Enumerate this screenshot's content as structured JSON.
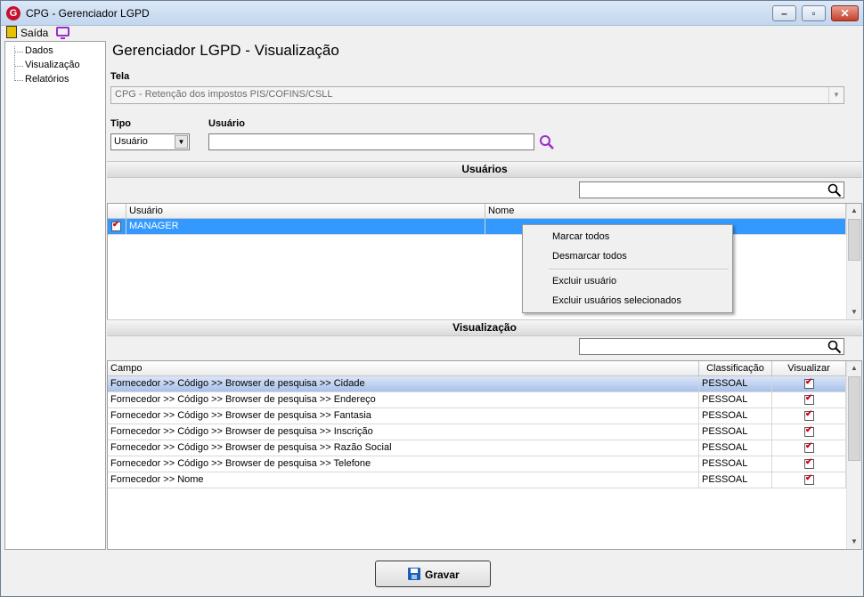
{
  "window": {
    "title": "CPG - Gerenciador LGPD"
  },
  "menubar": {
    "saida": "Saída"
  },
  "sidebar": {
    "items": [
      "Dados",
      "Visualização",
      "Relatórios"
    ]
  },
  "page": {
    "heading": "Gerenciador LGPD - Visualização"
  },
  "form": {
    "tela_label": "Tela",
    "tela_value": "CPG - Retenção dos impostos PIS/COFINS/CSLL",
    "tipo_label": "Tipo",
    "tipo_value": "Usuário",
    "usuario_label": "Usuário",
    "usuario_value": ""
  },
  "usuarios_section": {
    "title": "Usuários",
    "columns": [
      "Usuário",
      "Nome"
    ],
    "rows": [
      {
        "checked": true,
        "usuario": "MANAGER",
        "nome": ""
      }
    ]
  },
  "context_menu": {
    "items": [
      "Marcar todos",
      "Desmarcar todos",
      "Excluir usuário",
      "Excluir usuários selecionados"
    ]
  },
  "visualizacao_section": {
    "title": "Visualização",
    "columns": [
      "Campo",
      "Classificação",
      "Visualizar"
    ],
    "rows": [
      {
        "campo": "Fornecedor >> Código >> Browser de pesquisa >> Cidade",
        "classificacao": "PESSOAL",
        "visualizar": true
      },
      {
        "campo": "Fornecedor >> Código >> Browser de pesquisa >> Endereço",
        "classificacao": "PESSOAL",
        "visualizar": true
      },
      {
        "campo": "Fornecedor >> Código >> Browser de pesquisa >> Fantasia",
        "classificacao": "PESSOAL",
        "visualizar": true
      },
      {
        "campo": "Fornecedor >> Código >> Browser de pesquisa >> Inscrição",
        "classificacao": "PESSOAL",
        "visualizar": true
      },
      {
        "campo": "Fornecedor >> Código >> Browser de pesquisa >> Razão Social",
        "classificacao": "PESSOAL",
        "visualizar": true
      },
      {
        "campo": "Fornecedor >> Código >> Browser de pesquisa >> Telefone",
        "classificacao": "PESSOAL",
        "visualizar": true
      },
      {
        "campo": "Fornecedor >> Nome",
        "classificacao": "PESSOAL",
        "visualizar": true
      }
    ]
  },
  "footer": {
    "gravar_label": "Gravar"
  },
  "colors": {
    "selection": "#3399ff",
    "accent_purple": "#9b2bcf",
    "check_red": "#d0021b"
  }
}
